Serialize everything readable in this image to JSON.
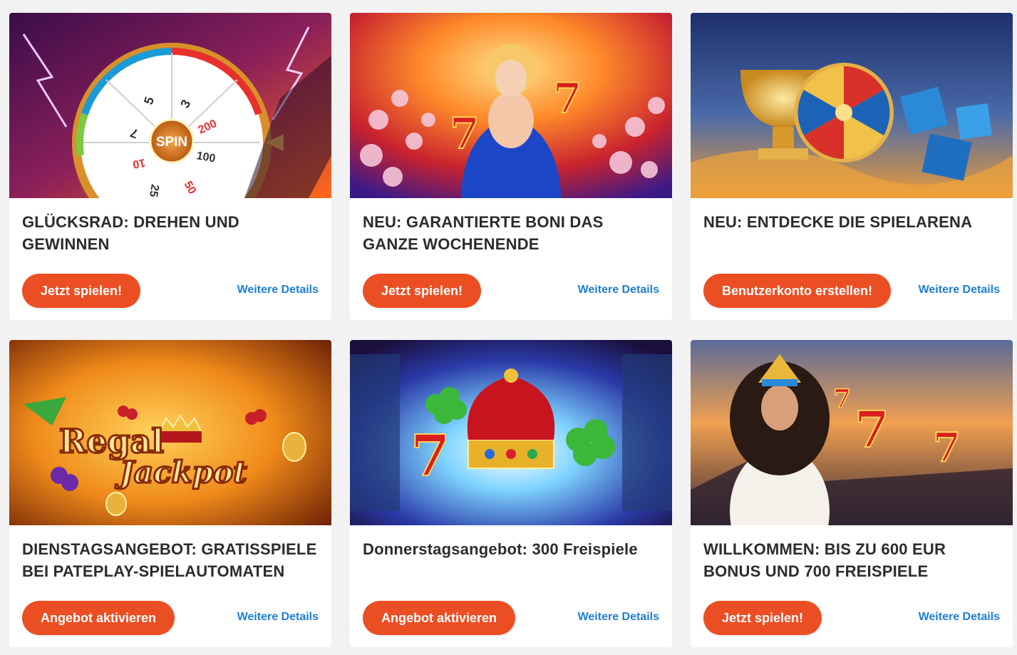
{
  "promos": [
    {
      "title": "GLÜCKSRAD: DREHEN UND GEWINNEN",
      "button": "Jetzt spielen!",
      "details": "Weitere Details",
      "art": {
        "wheel_center": "SPIN",
        "segments": [
          "5",
          "3",
          "200",
          "100",
          "50",
          "25",
          "10",
          "7"
        ]
      }
    },
    {
      "title": "NEU: GARANTIERTE BONI DAS GANZE WOCHENENDE",
      "button": "Jetzt spielen!",
      "details": "Weitere Details"
    },
    {
      "title": "NEU: ENTDECKE DIE SPIELARENA",
      "button": "Benutzerkonto erstellen!",
      "details": "Weitere Details"
    },
    {
      "title": "DIENSTAGSANGEBOT: GRATISSPIELE BEI PATEPLAY-SPIELAUTOMATEN",
      "button": "Angebot aktivieren",
      "details": "Weitere Details",
      "art": {
        "logo_line1": "Regal",
        "logo_line2": "Jackpot"
      }
    },
    {
      "title": "Donnerstagsangebot: 300 Freispiele",
      "button": "Angebot aktivieren",
      "details": "Weitere Details"
    },
    {
      "title": "WILLKOMMEN: BIS ZU 600 EUR BONUS UND 700 FREISPIELE",
      "button": "Jetzt spielen!",
      "details": "Weitere Details"
    }
  ],
  "colors": {
    "button": "#ec4e23",
    "link": "#1f7fd0",
    "title": "#2c2c2c",
    "page_background": "#f2f2f3"
  }
}
